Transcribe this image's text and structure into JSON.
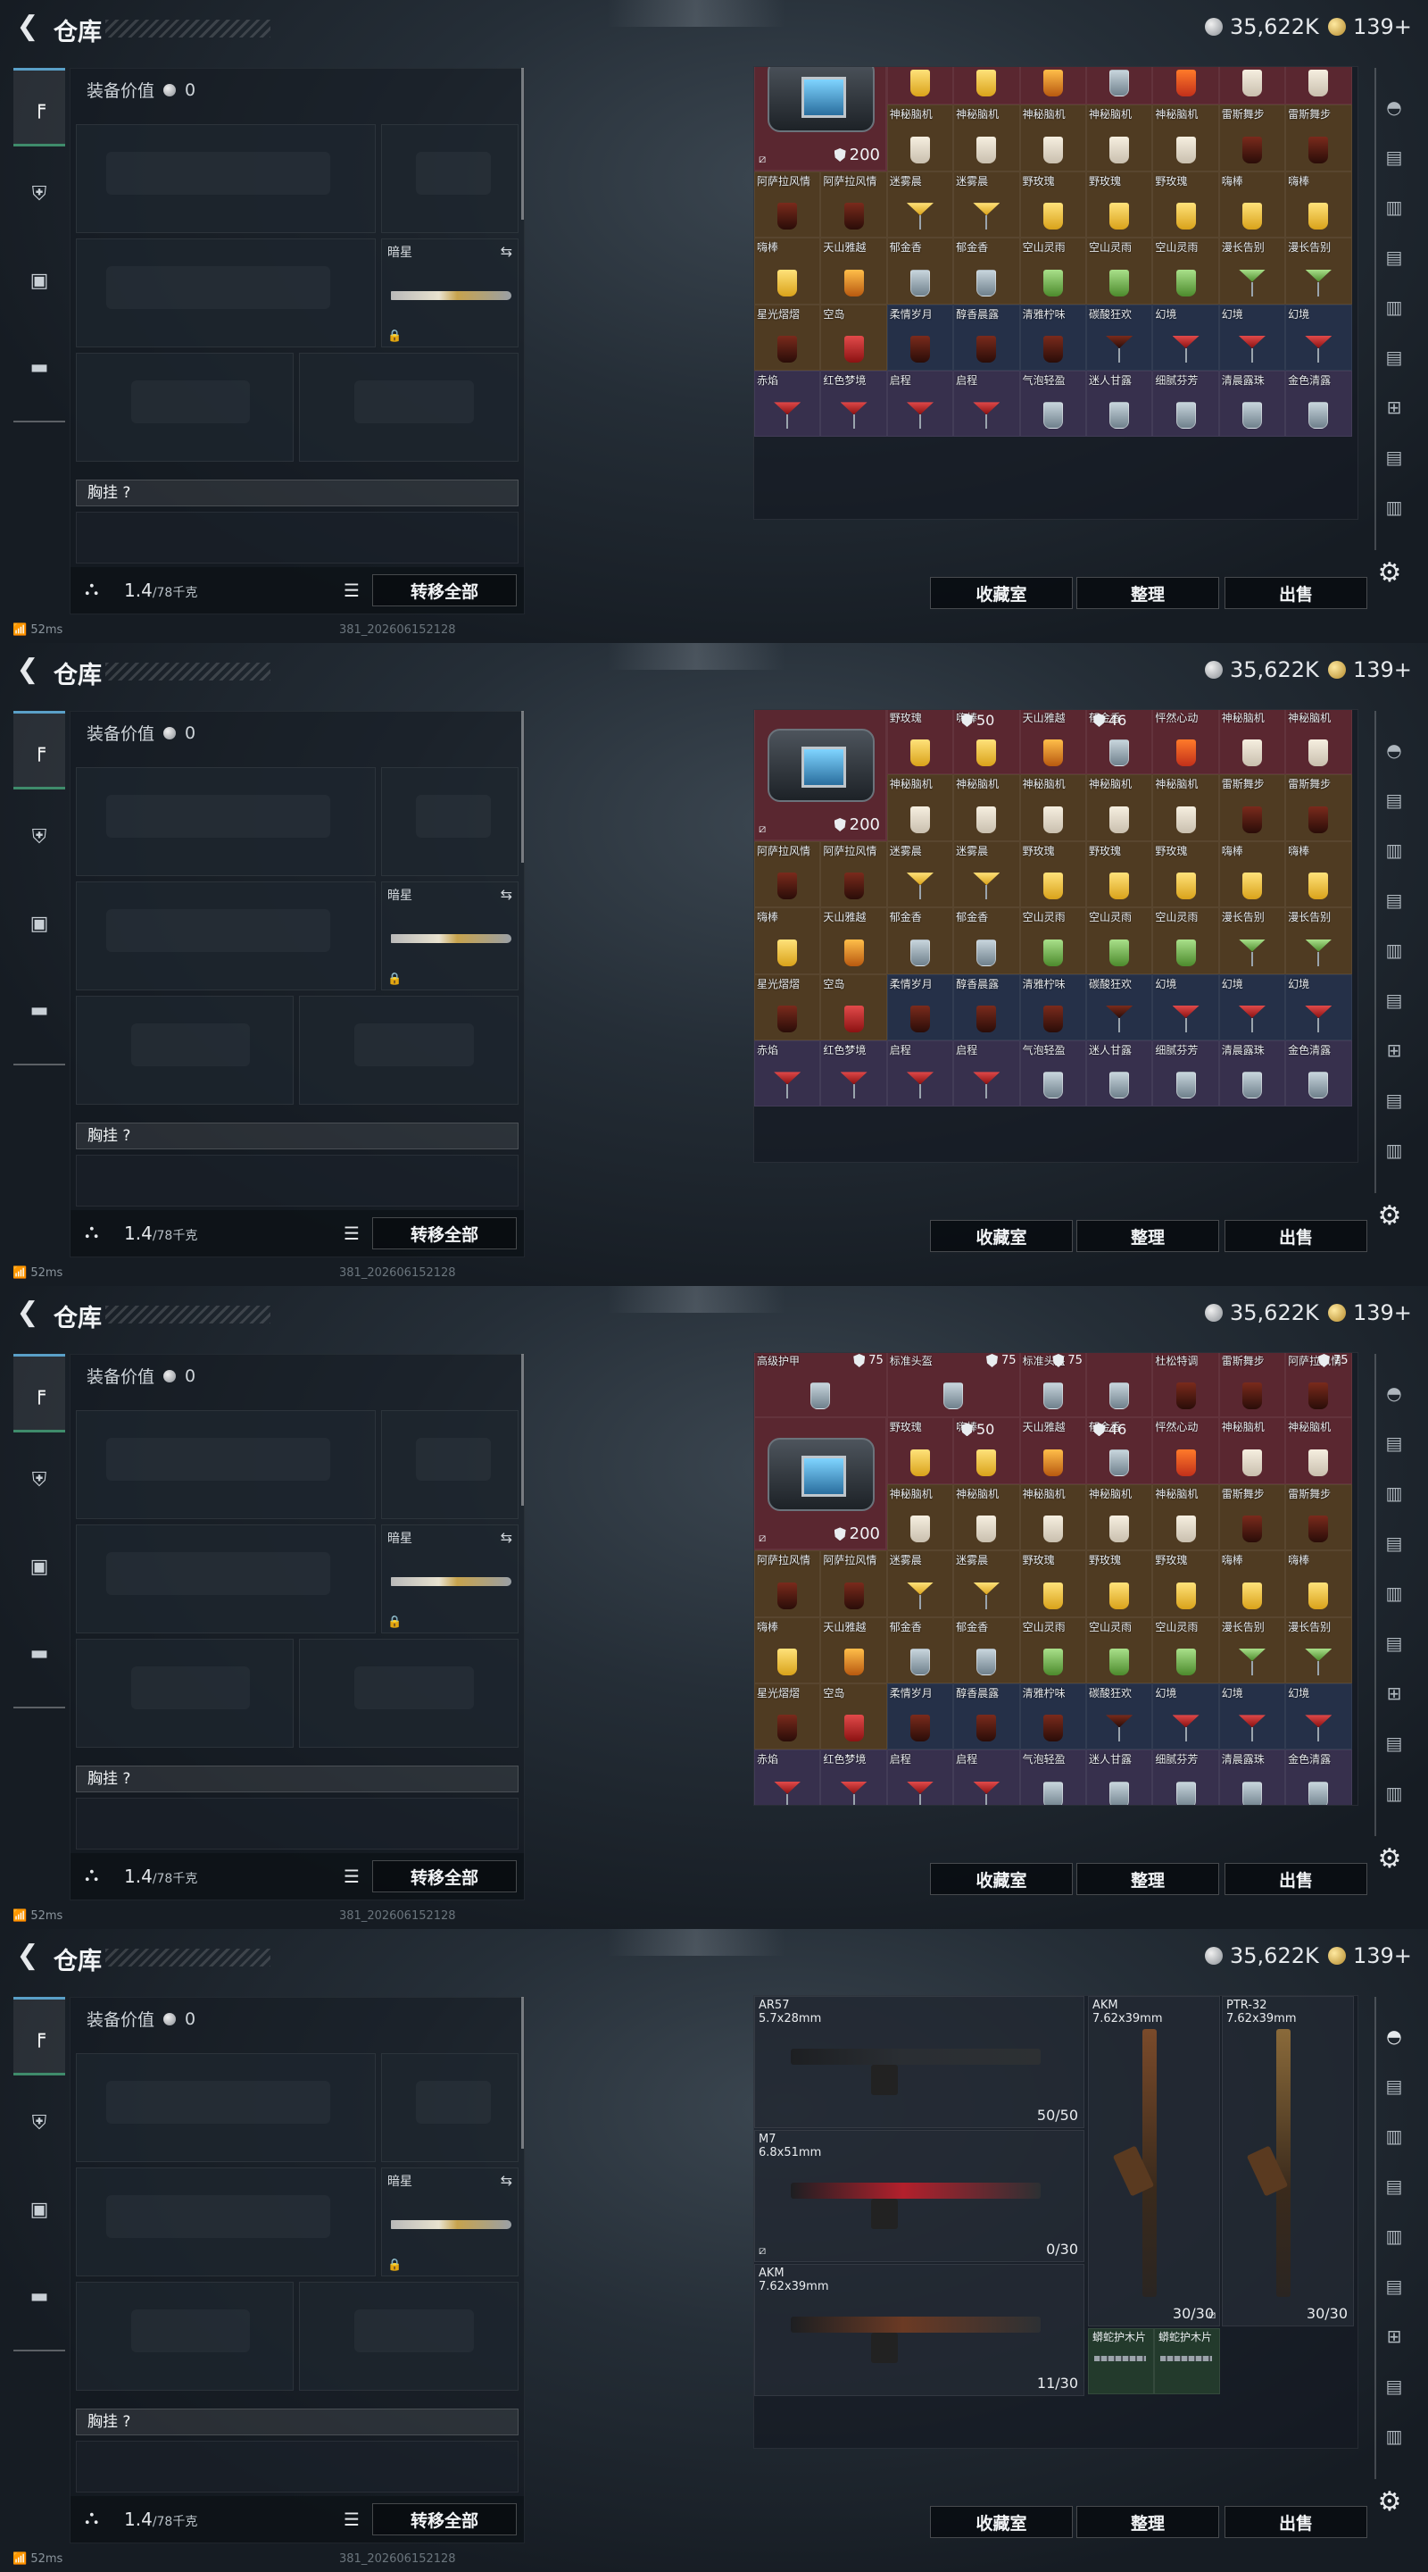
{
  "header": {
    "title": "仓库",
    "silver": "35,622K",
    "gold": "139+"
  },
  "equip": {
    "label": "装备价值",
    "value": "0",
    "secondary_weapon": "暗星",
    "vest_label": "胸挂",
    "vest_help": "?",
    "weight": "1.4",
    "weight_max": "/78千克",
    "transfer_all": "转移全部"
  },
  "actions": {
    "collection": "收藏室",
    "sort": "整理",
    "sell": "出售"
  },
  "status": {
    "ping": "52ms",
    "build": "381_20260615212​8"
  },
  "bag_item": {
    "durability": "200",
    "top_left_value": "50",
    "top_right_value": "46"
  },
  "screens": [
    {
      "pre_row": [
        {
          "name": "",
          "color": "c-red",
          "cup": "ice"
        },
        {
          "name": "",
          "color": "c-red",
          "cup": "ice"
        },
        {
          "name": "",
          "color": "c-red",
          "cup": "redd"
        },
        {
          "name": "",
          "color": "c-red",
          "cup": "dark"
        }
      ],
      "rows": [
        [
          {
            "name": "野玫瑰",
            "color": "c-red",
            "cup": "yellow"
          },
          {
            "name": "嗨棒",
            "color": "c-red",
            "cup": "yellow"
          },
          {
            "name": "天山雅越",
            "color": "c-red",
            "cup": "amber"
          },
          {
            "name": "郁金香",
            "color": "c-red",
            "cup": "ice"
          },
          {
            "name": "怦然心动",
            "color": "c-red",
            "cup": "orangeR"
          },
          {
            "name": "神秘脑机",
            "color": "c-red",
            "cup": "milk"
          },
          {
            "name": "神秘脑机",
            "color": "c-red",
            "cup": "milk"
          }
        ],
        [
          {
            "name": "神秘脑机",
            "color": "c-gold",
            "cup": "milk"
          },
          {
            "name": "神秘脑机",
            "color": "c-gold",
            "cup": "milk"
          },
          {
            "name": "神秘脑机",
            "color": "c-gold",
            "cup": "milk"
          },
          {
            "name": "神秘脑机",
            "color": "c-gold",
            "cup": "milk"
          },
          {
            "name": "神秘脑机",
            "color": "c-gold",
            "cup": "milk"
          },
          {
            "name": "雷斯舞步",
            "color": "c-gold",
            "cup": "dark"
          },
          {
            "name": "雷斯舞步",
            "color": "c-gold",
            "cup": "dark"
          },
          {
            "name": "雷斯舞步",
            "color": "c-gold",
            "cup": "dark"
          },
          {
            "name": "雷斯舞步",
            "color": "c-gold",
            "cup": "dark"
          }
        ],
        [
          {
            "name": "阿萨拉风情",
            "color": "c-gold",
            "cup": "dark"
          },
          {
            "name": "阿萨拉风情",
            "color": "c-gold",
            "cup": "dark"
          },
          {
            "name": "迷雾晨",
            "color": "c-gold",
            "cup": "mart-yellow"
          },
          {
            "name": "迷雾晨",
            "color": "c-gold",
            "cup": "mart-yellow"
          },
          {
            "name": "野玫瑰",
            "color": "c-gold",
            "cup": "yellow"
          },
          {
            "name": "野玫瑰",
            "color": "c-gold",
            "cup": "yellow"
          },
          {
            "name": "野玫瑰",
            "color": "c-gold",
            "cup": "yellow"
          },
          {
            "name": "嗨棒",
            "color": "c-gold",
            "cup": "yellow"
          },
          {
            "name": "嗨棒",
            "color": "c-gold",
            "cup": "yellow"
          }
        ],
        [
          {
            "name": "嗨棒",
            "color": "c-gold",
            "cup": "yellow"
          },
          {
            "name": "天山雅越",
            "color": "c-gold",
            "cup": "amber"
          },
          {
            "name": "郁金香",
            "color": "c-gold",
            "cup": "ice"
          },
          {
            "name": "郁金香",
            "color": "c-gold",
            "cup": "ice"
          },
          {
            "name": "空山灵雨",
            "color": "c-gold",
            "cup": "green"
          },
          {
            "name": "空山灵雨",
            "color": "c-gold",
            "cup": "green"
          },
          {
            "name": "空山灵雨",
            "color": "c-gold",
            "cup": "green"
          },
          {
            "name": "漫长告别",
            "color": "c-gold",
            "cup": "mart-green"
          },
          {
            "name": "漫长告别",
            "color": "c-gold",
            "cup": "mart-green"
          }
        ],
        [
          {
            "name": "星光熠熠",
            "color": "c-gold",
            "cup": "dark"
          },
          {
            "name": "空岛",
            "color": "c-gold",
            "cup": "redd"
          },
          {
            "name": "柔情岁月",
            "color": "c-blue",
            "cup": "dark"
          },
          {
            "name": "醇香晨露",
            "color": "c-blue",
            "cup": "dark"
          },
          {
            "name": "清雅柠味",
            "color": "c-blue",
            "cup": "dark"
          },
          {
            "name": "碳酸狂欢",
            "color": "c-blue",
            "cup": "mart-dark"
          },
          {
            "name": "幻境",
            "color": "c-blue",
            "cup": "mart-red"
          },
          {
            "name": "幻境",
            "color": "c-blue",
            "cup": "mart-red"
          },
          {
            "name": "幻境",
            "color": "c-blue",
            "cup": "mart-red"
          }
        ],
        [
          {
            "name": "赤焰",
            "color": "c-purp",
            "cup": "mart-red"
          },
          {
            "name": "红色梦境",
            "color": "c-purp",
            "cup": "mart-red"
          },
          {
            "name": "启程",
            "color": "c-purp",
            "cup": "mart-red"
          },
          {
            "name": "启程",
            "color": "c-purp",
            "cup": "mart-red"
          },
          {
            "name": "气泡轻盈",
            "color": "c-purp",
            "cup": "ice"
          },
          {
            "name": "迷人甘露",
            "color": "c-purp",
            "cup": "ice"
          },
          {
            "name": "细腻芬芳",
            "color": "c-purp",
            "cup": "ice"
          },
          {
            "name": "清晨露珠",
            "color": "c-purp",
            "cup": "ice"
          },
          {
            "name": "金色清露",
            "color": "c-purp",
            "cup": "ice"
          }
        ]
      ]
    },
    {
      "pre_row": [],
      "rows": [
        [
          {
            "name": "野玫瑰",
            "color": "c-red",
            "cup": "yellow"
          },
          {
            "name": "嗨棒",
            "color": "c-red",
            "cup": "yellow"
          },
          {
            "name": "天山雅越",
            "color": "c-red",
            "cup": "amber"
          },
          {
            "name": "郁金香",
            "color": "c-red",
            "cup": "ice"
          },
          {
            "name": "怦然心动",
            "color": "c-red",
            "cup": "orangeR"
          },
          {
            "name": "神秘脑机",
            "color": "c-red",
            "cup": "milk"
          },
          {
            "name": "神秘脑机",
            "color": "c-red",
            "cup": "milk"
          }
        ],
        [
          {
            "name": "神秘脑机",
            "color": "c-gold",
            "cup": "milk"
          },
          {
            "name": "神秘脑机",
            "color": "c-gold",
            "cup": "milk"
          },
          {
            "name": "神秘脑机",
            "color": "c-gold",
            "cup": "milk"
          },
          {
            "name": "神秘脑机",
            "color": "c-gold",
            "cup": "milk"
          },
          {
            "name": "神秘脑机",
            "color": "c-gold",
            "cup": "milk"
          },
          {
            "name": "雷斯舞步",
            "color": "c-gold",
            "cup": "dark"
          },
          {
            "name": "雷斯舞步",
            "color": "c-gold",
            "cup": "dark"
          },
          {
            "name": "雷斯舞步",
            "color": "c-gold",
            "cup": "dark"
          },
          {
            "name": "雷斯舞步",
            "color": "c-gold",
            "cup": "dark"
          }
        ],
        [
          {
            "name": "阿萨拉风情",
            "color": "c-gold",
            "cup": "dark"
          },
          {
            "name": "阿萨拉风情",
            "color": "c-gold",
            "cup": "dark"
          },
          {
            "name": "迷雾晨",
            "color": "c-gold",
            "cup": "mart-yellow"
          },
          {
            "name": "迷雾晨",
            "color": "c-gold",
            "cup": "mart-yellow"
          },
          {
            "name": "野玫瑰",
            "color": "c-gold",
            "cup": "yellow"
          },
          {
            "name": "野玫瑰",
            "color": "c-gold",
            "cup": "yellow"
          },
          {
            "name": "野玫瑰",
            "color": "c-gold",
            "cup": "yellow"
          },
          {
            "name": "嗨棒",
            "color": "c-gold",
            "cup": "yellow"
          },
          {
            "name": "嗨棒",
            "color": "c-gold",
            "cup": "yellow"
          }
        ],
        [
          {
            "name": "嗨棒",
            "color": "c-gold",
            "cup": "yellow"
          },
          {
            "name": "天山雅越",
            "color": "c-gold",
            "cup": "amber"
          },
          {
            "name": "郁金香",
            "color": "c-gold",
            "cup": "ice"
          },
          {
            "name": "郁金香",
            "color": "c-gold",
            "cup": "ice"
          },
          {
            "name": "空山灵雨",
            "color": "c-gold",
            "cup": "green"
          },
          {
            "name": "空山灵雨",
            "color": "c-gold",
            "cup": "green"
          },
          {
            "name": "空山灵雨",
            "color": "c-gold",
            "cup": "green"
          },
          {
            "name": "漫长告别",
            "color": "c-gold",
            "cup": "mart-green"
          },
          {
            "name": "漫长告别",
            "color": "c-gold",
            "cup": "mart-green"
          }
        ],
        [
          {
            "name": "星光熠熠",
            "color": "c-gold",
            "cup": "dark"
          },
          {
            "name": "空岛",
            "color": "c-gold",
            "cup": "redd"
          },
          {
            "name": "柔情岁月",
            "color": "c-blue",
            "cup": "dark"
          },
          {
            "name": "醇香晨露",
            "color": "c-blue",
            "cup": "dark"
          },
          {
            "name": "清雅柠味",
            "color": "c-blue",
            "cup": "dark"
          },
          {
            "name": "碳酸狂欢",
            "color": "c-blue",
            "cup": "mart-dark"
          },
          {
            "name": "幻境",
            "color": "c-blue",
            "cup": "mart-red"
          },
          {
            "name": "幻境",
            "color": "c-blue",
            "cup": "mart-red"
          },
          {
            "name": "幻境",
            "color": "c-blue",
            "cup": "mart-red"
          }
        ],
        [
          {
            "name": "赤焰",
            "color": "c-purp",
            "cup": "mart-red"
          },
          {
            "name": "红色梦境",
            "color": "c-purp",
            "cup": "mart-red"
          },
          {
            "name": "启程",
            "color": "c-purp",
            "cup": "mart-red"
          },
          {
            "name": "启程",
            "color": "c-purp",
            "cup": "mart-red"
          },
          {
            "name": "气泡轻盈",
            "color": "c-purp",
            "cup": "ice"
          },
          {
            "name": "迷人甘露",
            "color": "c-purp",
            "cup": "ice"
          },
          {
            "name": "细腻芬芳",
            "color": "c-purp",
            "cup": "ice"
          },
          {
            "name": "清晨露珠",
            "color": "c-purp",
            "cup": "ice"
          },
          {
            "name": "金色清露",
            "color": "c-purp",
            "cup": "ice"
          }
        ]
      ]
    },
    {
      "armor_row": [
        {
          "name": "高级护甲",
          "val": "75"
        },
        {
          "name": "标准头盔",
          "val": "75"
        },
        {
          "name": "标准头盔",
          "val": "75"
        },
        {
          "name": "",
          "val": ""
        },
        {
          "name": "杜松特调",
          "val": ""
        },
        {
          "name": "雷斯舞步",
          "val": ""
        },
        {
          "name": "阿萨拉风情",
          "val": "75"
        }
      ],
      "rows": [
        [
          {
            "name": "野玫瑰",
            "color": "c-red",
            "cup": "yellow"
          },
          {
            "name": "嗨棒",
            "color": "c-red",
            "cup": "yellow"
          },
          {
            "name": "天山雅越",
            "color": "c-red",
            "cup": "amber"
          },
          {
            "name": "郁金香",
            "color": "c-red",
            "cup": "ice"
          },
          {
            "name": "怦然心动",
            "color": "c-red",
            "cup": "orangeR"
          },
          {
            "name": "神秘脑机",
            "color": "c-red",
            "cup": "milk"
          },
          {
            "name": "神秘脑机",
            "color": "c-red",
            "cup": "milk"
          }
        ],
        [
          {
            "name": "神秘脑机",
            "color": "c-gold",
            "cup": "milk"
          },
          {
            "name": "神秘脑机",
            "color": "c-gold",
            "cup": "milk"
          },
          {
            "name": "神秘脑机",
            "color": "c-gold",
            "cup": "milk"
          },
          {
            "name": "神秘脑机",
            "color": "c-gold",
            "cup": "milk"
          },
          {
            "name": "神秘脑机",
            "color": "c-gold",
            "cup": "milk"
          },
          {
            "name": "雷斯舞步",
            "color": "c-gold",
            "cup": "dark"
          },
          {
            "name": "雷斯舞步",
            "color": "c-gold",
            "cup": "dark"
          },
          {
            "name": "雷斯舞步",
            "color": "c-gold",
            "cup": "dark"
          },
          {
            "name": "雷斯舞步",
            "color": "c-gold",
            "cup": "dark"
          }
        ],
        [
          {
            "name": "阿萨拉风情",
            "color": "c-gold",
            "cup": "dark"
          },
          {
            "name": "阿萨拉风情",
            "color": "c-gold",
            "cup": "dark"
          },
          {
            "name": "迷雾晨",
            "color": "c-gold",
            "cup": "mart-yellow"
          },
          {
            "name": "迷雾晨",
            "color": "c-gold",
            "cup": "mart-yellow"
          },
          {
            "name": "野玫瑰",
            "color": "c-gold",
            "cup": "yellow"
          },
          {
            "name": "野玫瑰",
            "color": "c-gold",
            "cup": "yellow"
          },
          {
            "name": "野玫瑰",
            "color": "c-gold",
            "cup": "yellow"
          },
          {
            "name": "嗨棒",
            "color": "c-gold",
            "cup": "yellow"
          },
          {
            "name": "嗨棒",
            "color": "c-gold",
            "cup": "yellow"
          }
        ],
        [
          {
            "name": "嗨棒",
            "color": "c-gold",
            "cup": "yellow"
          },
          {
            "name": "天山雅越",
            "color": "c-gold",
            "cup": "amber"
          },
          {
            "name": "郁金香",
            "color": "c-gold",
            "cup": "ice"
          },
          {
            "name": "郁金香",
            "color": "c-gold",
            "cup": "ice"
          },
          {
            "name": "空山灵雨",
            "color": "c-gold",
            "cup": "green"
          },
          {
            "name": "空山灵雨",
            "color": "c-gold",
            "cup": "green"
          },
          {
            "name": "空山灵雨",
            "color": "c-gold",
            "cup": "green"
          },
          {
            "name": "漫长告别",
            "color": "c-gold",
            "cup": "mart-green"
          },
          {
            "name": "漫长告别",
            "color": "c-gold",
            "cup": "mart-green"
          }
        ],
        [
          {
            "name": "星光熠熠",
            "color": "c-gold",
            "cup": "dark"
          },
          {
            "name": "空岛",
            "color": "c-gold",
            "cup": "redd"
          },
          {
            "name": "柔情岁月",
            "color": "c-blue",
            "cup": "dark"
          },
          {
            "name": "醇香晨露",
            "color": "c-blue",
            "cup": "dark"
          },
          {
            "name": "清雅柠味",
            "color": "c-blue",
            "cup": "dark"
          },
          {
            "name": "碳酸狂欢",
            "color": "c-blue",
            "cup": "mart-dark"
          },
          {
            "name": "幻境",
            "color": "c-blue",
            "cup": "mart-red"
          },
          {
            "name": "幻境",
            "color": "c-blue",
            "cup": "mart-red"
          },
          {
            "name": "幻境",
            "color": "c-blue",
            "cup": "mart-red"
          }
        ],
        [
          {
            "name": "赤焰",
            "color": "c-purp",
            "cup": "mart-red"
          },
          {
            "name": "红色梦境",
            "color": "c-purp",
            "cup": "mart-red"
          },
          {
            "name": "启程",
            "color": "c-purp",
            "cup": "mart-red"
          },
          {
            "name": "启程",
            "color": "c-purp",
            "cup": "mart-red"
          },
          {
            "name": "气泡轻盈",
            "color": "c-purp",
            "cup": "ice"
          },
          {
            "name": "迷人甘露",
            "color": "c-purp",
            "cup": "ice"
          },
          {
            "name": "细腻芬芳",
            "color": "c-purp",
            "cup": "ice"
          },
          {
            "name": "清晨露珠",
            "color": "c-purp",
            "cup": "ice"
          },
          {
            "name": "金色清露",
            "color": "c-purp",
            "cup": "ice"
          }
        ]
      ]
    }
  ],
  "weapons": [
    {
      "name": "AR57",
      "caliber": "5.7x28mm",
      "ammo": "50/50",
      "color": "#2a2e33"
    },
    {
      "name": "M7",
      "caliber": "6.8x51mm",
      "ammo": "0/30",
      "color": "#b3202c"
    },
    {
      "name": "AKM",
      "caliber": "7.62x39mm",
      "ammo": "11/30",
      "color": "#6b3a24"
    },
    {
      "name": "AKM",
      "caliber": "7.62x39mm",
      "ammo": "30/30",
      "color": "#7a4a2a"
    },
    {
      "name": "PTR-32",
      "caliber": "7.62x39mm",
      "ammo": "30/30",
      "color": "#8a6a3a"
    }
  ],
  "tactical": [
    {
      "name": "蟒蛇护木片"
    },
    {
      "name": "蟒蛇护木片"
    }
  ]
}
